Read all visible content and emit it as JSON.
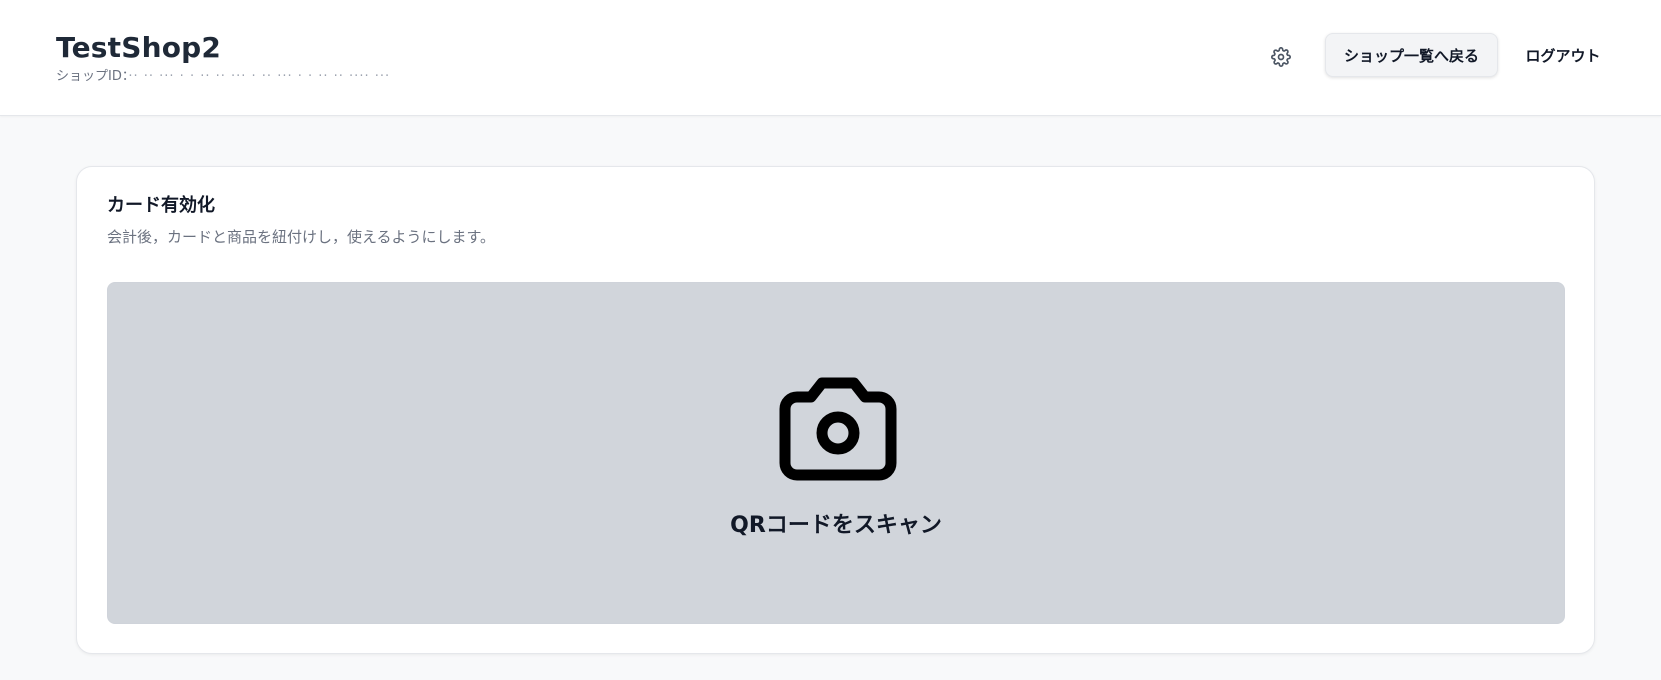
{
  "header": {
    "shop_name": "TestShop2",
    "shop_id_label": "ショップID：",
    "shop_id_value": "·· ·· ··· · · ·· ·· ··· ·  ·· ··· · · ·· ·· ···· ···",
    "settings_icon": "gear-icon",
    "back_button_label": "ショップ一覧へ戻る",
    "logout_label": "ログアウト"
  },
  "card": {
    "title": "カード有効化",
    "description": "会計後，カードと商品を紐付けし，使えるようにします。",
    "scan": {
      "icon": "camera-icon",
      "label": "QRコードをスキャン"
    }
  },
  "colors": {
    "page_background": "#f8f9fa",
    "scan_area_background": "#d1d5db",
    "text_primary": "#111827",
    "text_secondary": "#6b7280"
  }
}
